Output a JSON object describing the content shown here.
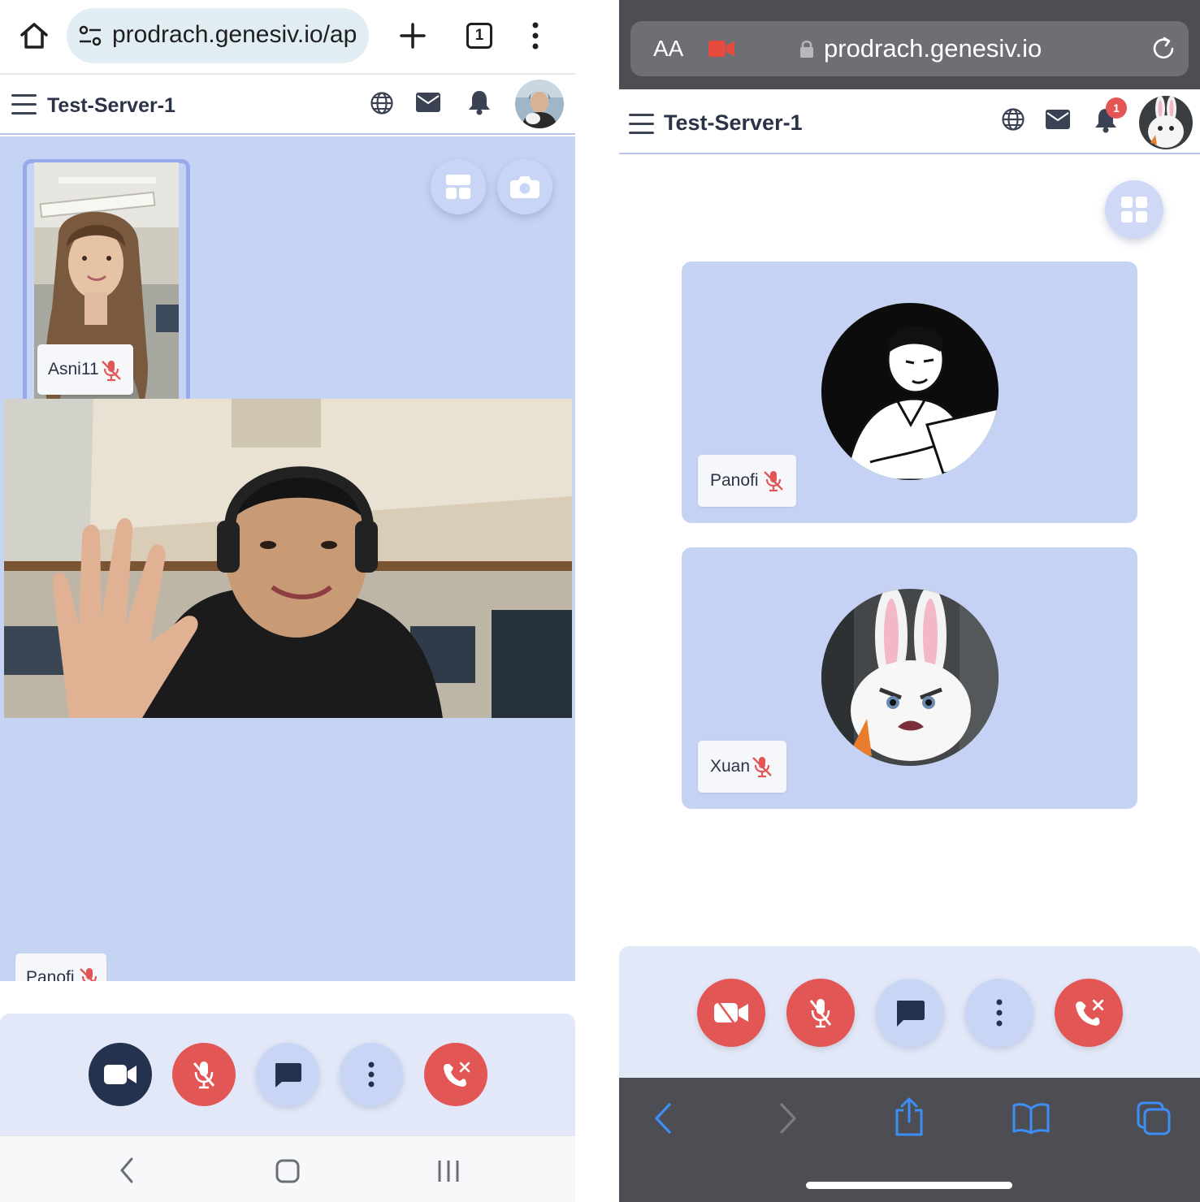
{
  "left_phone": {
    "browser": {
      "url": "prodrach.genesiv.io/ap",
      "tab_count": "1"
    },
    "header": {
      "server_name": "Test-Server-1"
    },
    "stage": {
      "participants": [
        {
          "name": "Asni11",
          "mic": "muted"
        },
        {
          "name": "Panofi",
          "mic": "muted"
        }
      ]
    },
    "controls": [
      "video-on",
      "mic-muted",
      "chat",
      "more",
      "end-call"
    ]
  },
  "right_phone": {
    "browser": {
      "text_size": "AA",
      "url": "prodrach.genesiv.io"
    },
    "header": {
      "server_name": "Test-Server-1",
      "notification_count": "1"
    },
    "participants": [
      {
        "name": "Panofi",
        "mic": "muted"
      },
      {
        "name": "Xuan",
        "mic": "muted"
      }
    ],
    "controls": [
      "video-off",
      "mic-muted",
      "chat",
      "more",
      "end-call"
    ]
  },
  "colors": {
    "stage_bg": "#c6d4f4",
    "control_bar_bg": "#e2e8f7",
    "danger": "#e35656",
    "navy": "#24324f",
    "header_text": "#2b3347"
  }
}
